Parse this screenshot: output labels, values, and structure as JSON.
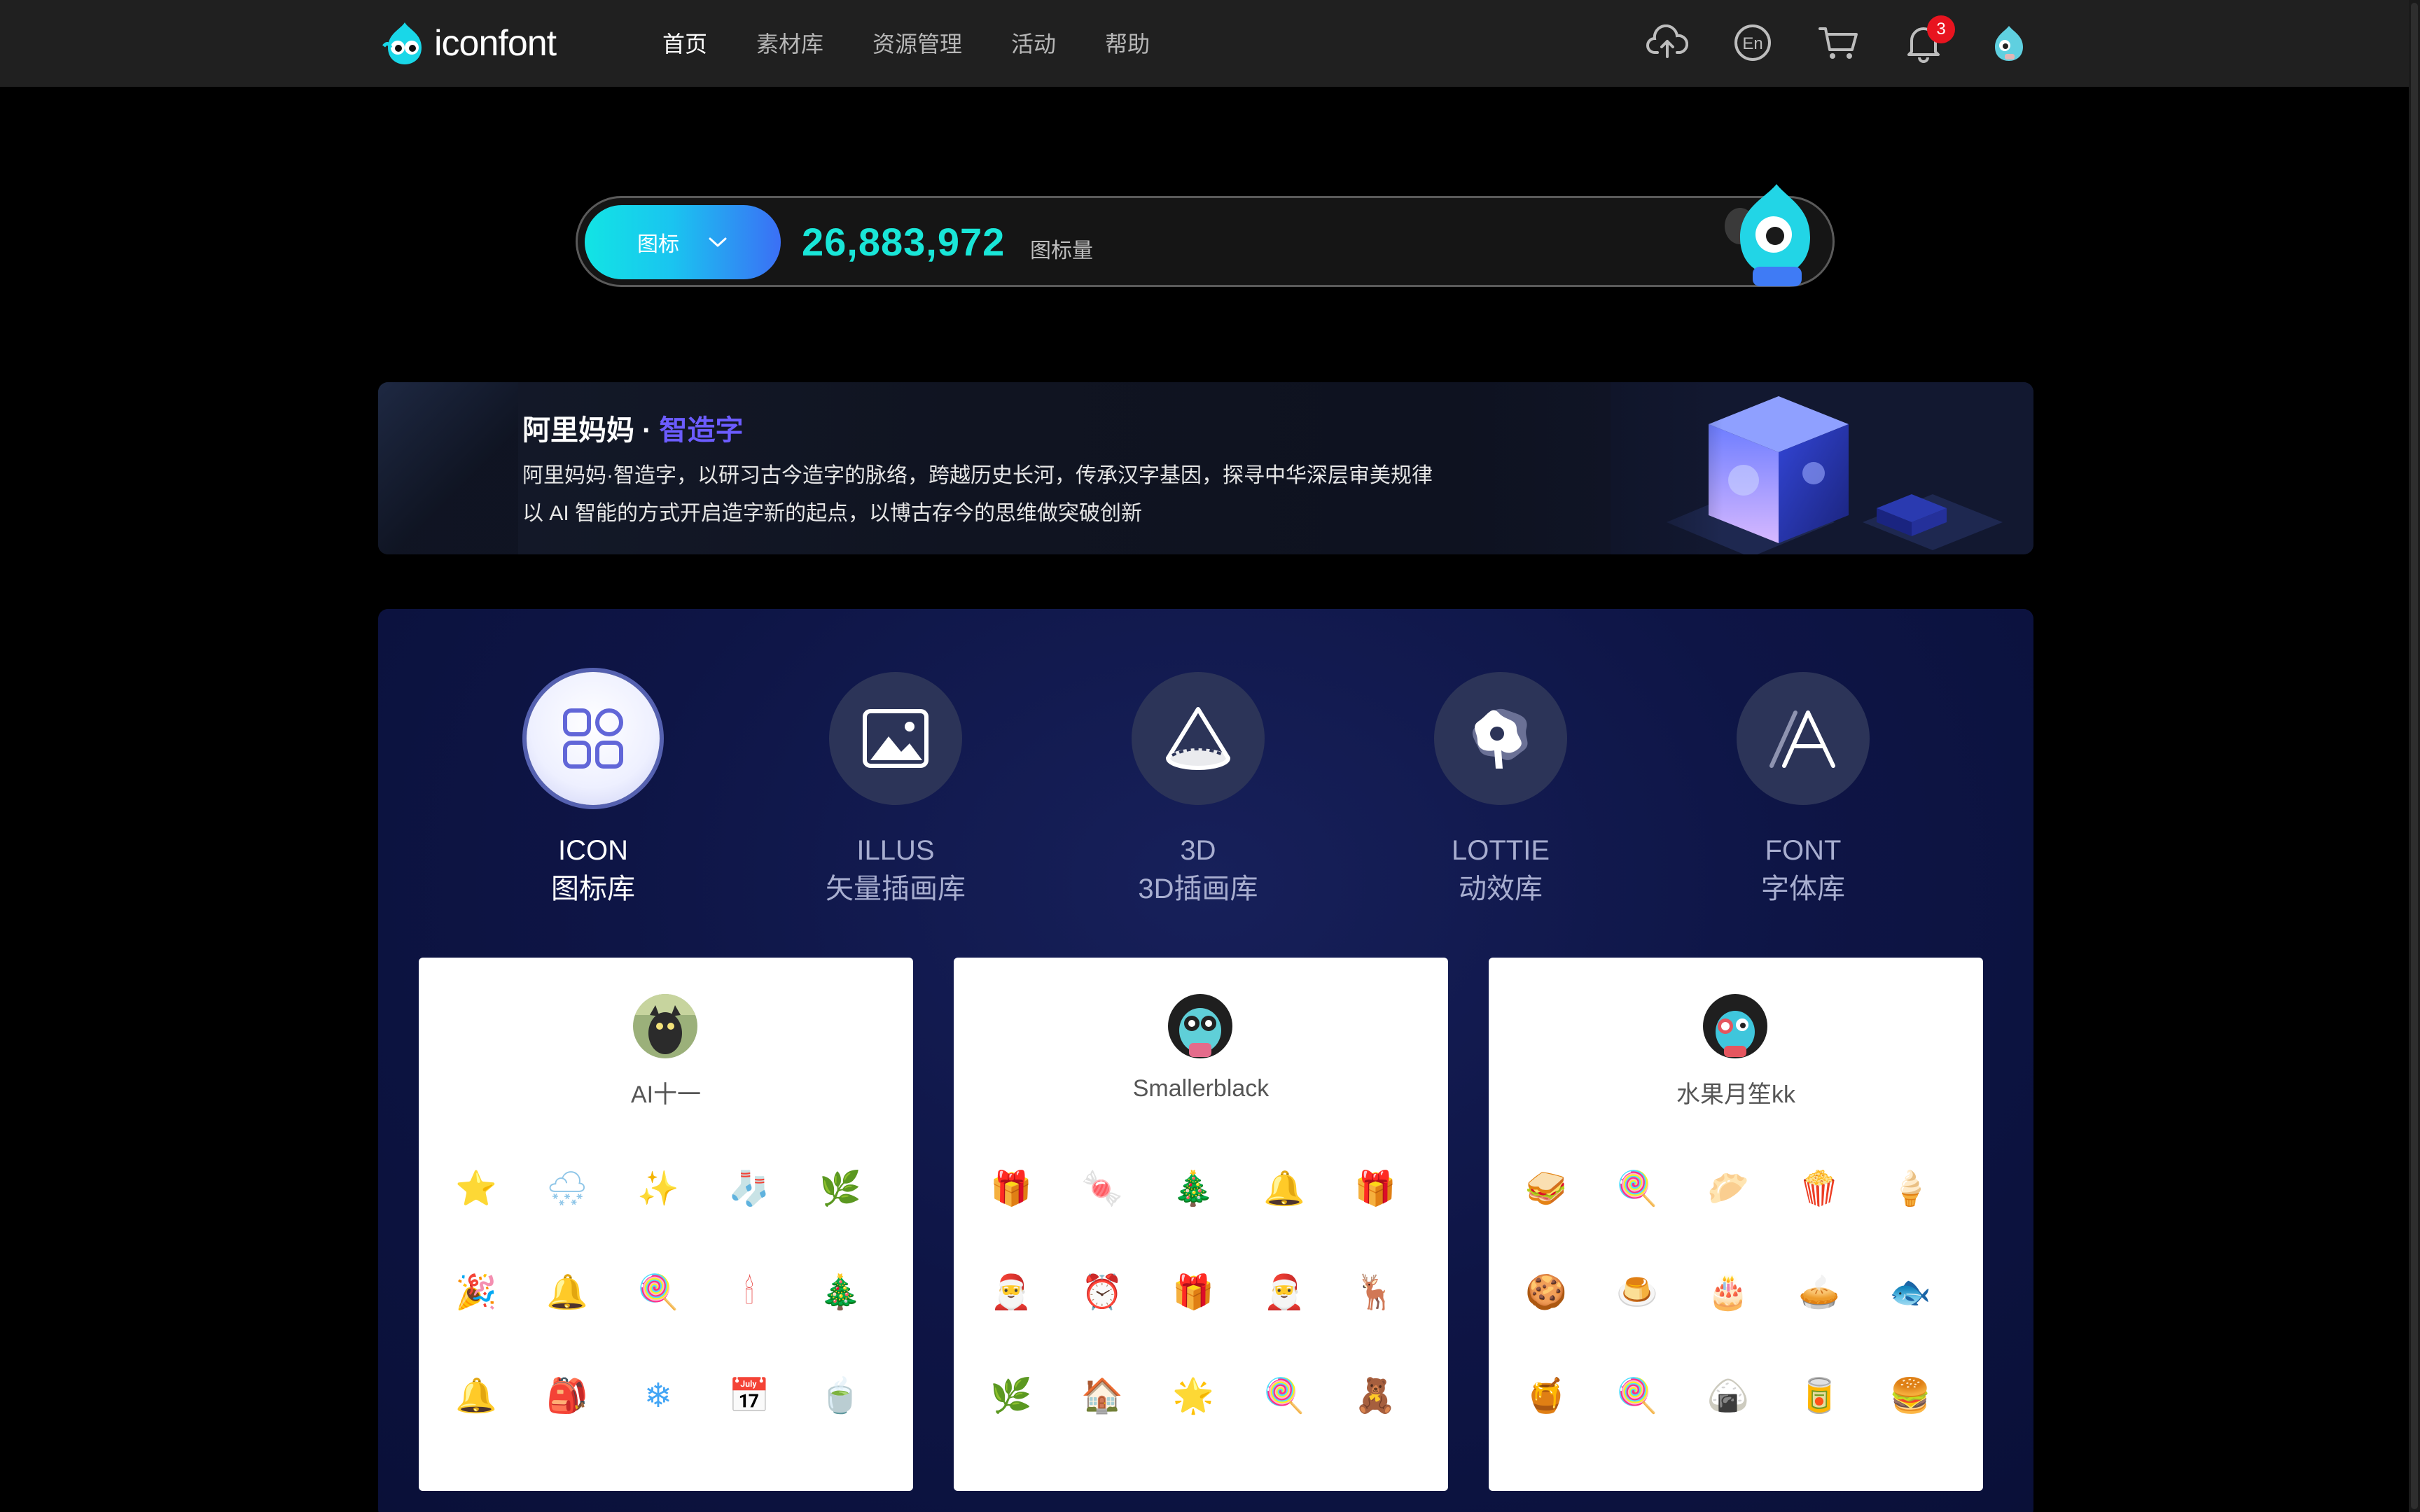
{
  "header": {
    "logo_text": "iconfont",
    "nav": [
      "首页",
      "素材库",
      "资源管理",
      "活动",
      "帮助"
    ],
    "active_nav": "首页",
    "icons": [
      "upload-cloud-icon",
      "language-en-icon",
      "cart-icon",
      "bell-icon",
      "user-avatar"
    ],
    "lang_label": "En",
    "notification_count": "3"
  },
  "search": {
    "type_label": "图标",
    "count": "26,883,972",
    "count_unit": "图标量"
  },
  "banner": {
    "title_main": "阿里妈妈 · ",
    "title_highlight": "智造字",
    "line1": "阿里妈妈·智造字，以研习古今造字的脉络，跨越历史长河，传承汉字基因，探寻中华深层审美规律",
    "line2": "以 AI 智能的方式开启造字新的起点，以博古存今的思维做突破创新"
  },
  "categories": [
    {
      "en": "ICON",
      "cn": "图标库",
      "icon": "grid-apps-icon",
      "active": true
    },
    {
      "en": "ILLUS",
      "cn": "矢量插画库",
      "icon": "image-icon",
      "active": false
    },
    {
      "en": "3D",
      "cn": "3D插画库",
      "icon": "cone-3d-icon",
      "active": false
    },
    {
      "en": "LOTTIE",
      "cn": "动效库",
      "icon": "star-shape-icon",
      "active": false
    },
    {
      "en": "FONT",
      "cn": "字体库",
      "icon": "font-a-icon",
      "active": false
    }
  ],
  "cards": [
    {
      "name": "AI十一",
      "icons": [
        "⭐",
        "🌨",
        "✨",
        "🧦",
        "🌿",
        "🎉",
        "🔔",
        "🍭",
        "🕯",
        "🎄",
        "🔔",
        "🎒",
        "❄",
        "📅",
        "🍵"
      ]
    },
    {
      "name": "Smallerblack",
      "icons": [
        "🎁",
        "🍬",
        "🎄",
        "🔔",
        "🎁",
        "🎅",
        "⏰",
        "🎁",
        "🎅",
        "🦌",
        "🌿",
        "🏠",
        "🌟",
        "🍭",
        "🧸"
      ]
    },
    {
      "name": "水果月笙kk",
      "icons": [
        "🥪",
        "🍭",
        "🥟",
        "🍿",
        "🍦",
        "🍪",
        "🍮",
        "🎂",
        "🥧",
        "🐟",
        "🍯",
        "🍭",
        "🍙",
        "🥫",
        "🍔"
      ]
    }
  ],
  "colors": {
    "accent_cyan": "#19e6d8",
    "accent_purple": "#6c5cff",
    "badge_red": "#e8141f",
    "panel_bg": "#0e1546"
  }
}
